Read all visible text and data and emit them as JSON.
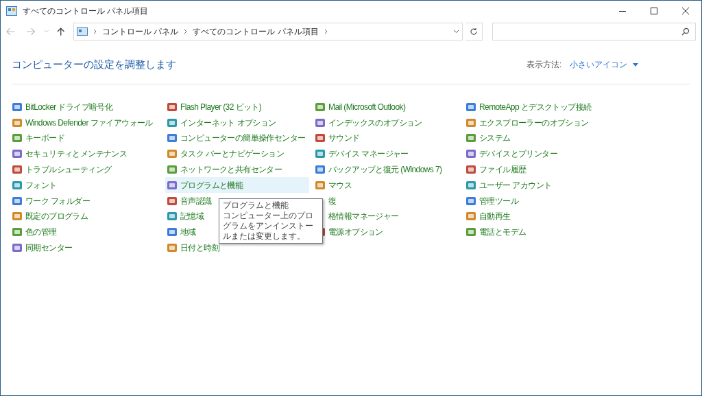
{
  "window": {
    "title": "すべてのコントロール パネル項目"
  },
  "address": {
    "crumbs": [
      "コントロール パネル",
      "すべてのコントロール パネル項目"
    ]
  },
  "heading": "コンピューターの設定を調整します",
  "view": {
    "label": "表示方法:",
    "value": "小さいアイコン"
  },
  "columns": [
    [
      {
        "label": "BitLocker ドライブ暗号化",
        "selected": false
      },
      {
        "label": "Windows Defender ファイアウォール",
        "selected": false
      },
      {
        "label": "キーボード",
        "selected": false
      },
      {
        "label": "セキュリティとメンテナンス",
        "selected": false
      },
      {
        "label": "トラブルシューティング",
        "selected": false
      },
      {
        "label": "フォント",
        "selected": false
      },
      {
        "label": "ワーク フォルダー",
        "selected": false
      },
      {
        "label": "既定のプログラム",
        "selected": false
      },
      {
        "label": "色の管理",
        "selected": false
      },
      {
        "label": "同期センター",
        "selected": false
      }
    ],
    [
      {
        "label": "Flash Player (32 ビット)",
        "selected": false
      },
      {
        "label": "インターネット オプション",
        "selected": false
      },
      {
        "label": "コンピューターの簡単操作センター",
        "selected": false
      },
      {
        "label": "タスク バーとナビゲーション",
        "selected": false
      },
      {
        "label": "ネットワークと共有センター",
        "selected": false
      },
      {
        "label": "プログラムと機能",
        "selected": true
      },
      {
        "label": "音声認識",
        "selected": false
      },
      {
        "label": "記憶域",
        "selected": false
      },
      {
        "label": "地域",
        "selected": false
      },
      {
        "label": "日付と時刻",
        "selected": false
      }
    ],
    [
      {
        "label": "Mail (Microsoft Outlook)",
        "selected": false
      },
      {
        "label": "インデックスのオプション",
        "selected": false
      },
      {
        "label": "サウンド",
        "selected": false
      },
      {
        "label": "デバイス マネージャー",
        "selected": false
      },
      {
        "label": "バックアップと復元 (Windows 7)",
        "selected": false
      },
      {
        "label": "マウス",
        "selected": false
      },
      {
        "label": "復",
        "selected": false,
        "kind": "covered"
      },
      {
        "label": "格情報マネージャー",
        "selected": false,
        "kind": "covered"
      },
      {
        "label": "電源オプション",
        "selected": false
      }
    ],
    [
      {
        "label": "RemoteApp とデスクトップ接続",
        "selected": false
      },
      {
        "label": "エクスプローラーのオプション",
        "selected": false
      },
      {
        "label": "システム",
        "selected": false
      },
      {
        "label": "デバイスとプリンター",
        "selected": false
      },
      {
        "label": "ファイル履歴",
        "selected": false
      },
      {
        "label": "ユーザー アカウント",
        "selected": false
      },
      {
        "label": "管理ツール",
        "selected": false
      },
      {
        "label": "自動再生",
        "selected": false
      },
      {
        "label": "電話とモデム",
        "selected": false
      }
    ]
  ],
  "tooltip": {
    "title": "プログラムと機能",
    "text": "コンピューター上のプログラムをアンインストールまたは変更します。"
  }
}
